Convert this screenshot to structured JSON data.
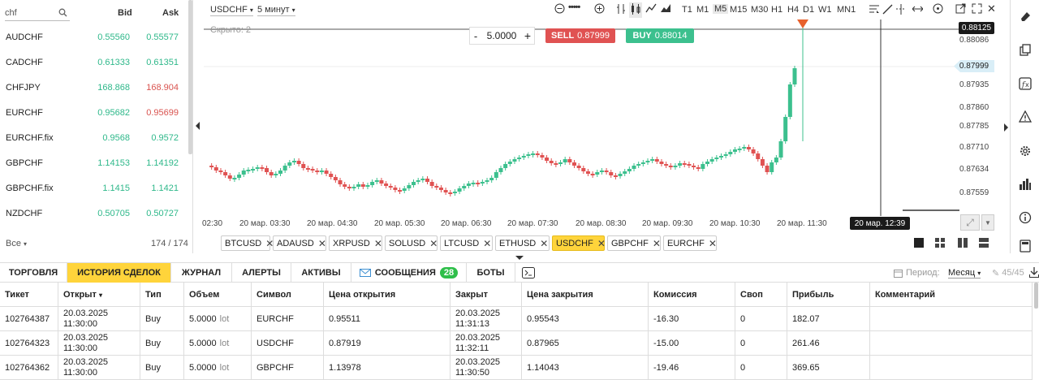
{
  "watchlist": {
    "search_value": "chf",
    "bid_header": "Bid",
    "ask_header": "Ask",
    "rows": [
      {
        "symbol": "AUDCHF",
        "bid": "0.55560",
        "ask": "0.55577",
        "bid_color": "g",
        "ask_color": "g"
      },
      {
        "symbol": "CADCHF",
        "bid": "0.61333",
        "ask": "0.61351",
        "bid_color": "g",
        "ask_color": "g"
      },
      {
        "symbol": "CHFJPY",
        "bid": "168.868",
        "ask": "168.904",
        "bid_color": "g",
        "ask_color": "r"
      },
      {
        "symbol": "EURCHF",
        "bid": "0.95682",
        "ask": "0.95699",
        "bid_color": "g",
        "ask_color": "r"
      },
      {
        "symbol": "EURCHF.fix",
        "bid": "0.9568",
        "ask": "0.9572",
        "bid_color": "g",
        "ask_color": "g"
      },
      {
        "symbol": "GBPCHF",
        "bid": "1.14153",
        "ask": "1.14192",
        "bid_color": "g",
        "ask_color": "g"
      },
      {
        "symbol": "GBPCHF.fix",
        "bid": "1.1415",
        "ask": "1.1421",
        "bid_color": "g",
        "ask_color": "g"
      },
      {
        "symbol": "NZDCHF",
        "bid": "0.50705",
        "ask": "0.50727",
        "bid_color": "g",
        "ask_color": "g"
      }
    ],
    "filter_label": "Все",
    "count": "174 / 174"
  },
  "toolbar": {
    "symbol": "USDCHF",
    "period": "5 минут",
    "timeframes": [
      "T1",
      "M1",
      "M5",
      "M15",
      "M30",
      "H1",
      "H4",
      "D1",
      "W1",
      "MN1"
    ],
    "active_timeframe": "M5"
  },
  "trade": {
    "hidden_label": "Скрыто: 2",
    "minus": "-",
    "plus": "+",
    "volume": "5.0000",
    "sell_label": "SELL",
    "sell_price": "0.87999",
    "buy_label": "BUY",
    "buy_price": "0.88014"
  },
  "chart": {
    "price_labels": [
      "0.88086",
      "0.87935",
      "0.87860",
      "0.87785",
      "0.87710",
      "0.87634",
      "0.87559"
    ],
    "current_price": "0.87999",
    "cursor_price": "0.88125",
    "time_labels": [
      "02:30",
      "20 мар. 03:30",
      "20 мар. 04:30",
      "20 мар. 05:30",
      "20 мар. 06:30",
      "20 мар. 07:30",
      "20 мар. 08:30",
      "20 мар. 09:30",
      "20 мар. 10:30",
      "20 мар. 11:30"
    ],
    "cursor_time": "20 мар. 12:39",
    "up_color": "#3cc08e",
    "down_color": "#e05252"
  },
  "symbol_tabs": [
    "BTCUSD",
    "ADAUSD",
    "XRPUSD",
    "SOLUSD",
    "LTCUSD",
    "ETHUSD",
    "USDCHF",
    "GBPCHF",
    "EURCHF"
  ],
  "active_symbol_tab": "USDCHF",
  "bottom_tabs": {
    "trading": "ТОРГОВЛЯ",
    "history": "ИСТОРИЯ СДЕЛОК",
    "journal": "ЖУРНАЛ",
    "alerts": "АЛЕРТЫ",
    "assets": "АКТИВЫ",
    "messages": "СООБЩЕНИЯ",
    "messages_count": "28",
    "bots": "БОТЫ"
  },
  "period_filter": {
    "label": "Период:",
    "value": "Месяц",
    "count": "45/45"
  },
  "table": {
    "headers": [
      "Тикет",
      "Открыт",
      "Тип",
      "Объем",
      "Символ",
      "Цена открытия",
      "Закрыт",
      "Цена закрытия",
      "Комиссия",
      "Своп",
      "Прибыль",
      "Комментарий"
    ],
    "lot_unit": "lot",
    "rows": [
      {
        "ticket": "102764387",
        "open_date": "20.03.2025",
        "open_time": "11:30:00",
        "type": "Buy",
        "volume": "5.0000",
        "symbol": "EURCHF",
        "open_price": "0.95511",
        "close_date": "20.03.2025",
        "close_time": "11:31:13",
        "close_price": "0.95543",
        "commission": "-16.30",
        "swap": "0",
        "profit": "182.07"
      },
      {
        "ticket": "102764323",
        "open_date": "20.03.2025",
        "open_time": "11:30:00",
        "type": "Buy",
        "volume": "5.0000",
        "symbol": "USDCHF",
        "open_price": "0.87919",
        "close_date": "20.03.2025",
        "close_time": "11:32:11",
        "close_price": "0.87965",
        "commission": "-15.00",
        "swap": "0",
        "profit": "261.46"
      },
      {
        "ticket": "102764362",
        "open_date": "20.03.2025",
        "open_time": "11:30:00",
        "type": "Buy",
        "volume": "5.0000",
        "symbol": "GBPCHF",
        "open_price": "1.13978",
        "close_date": "20.03.2025",
        "close_time": "11:30:50",
        "close_price": "1.14043",
        "commission": "-19.46",
        "swap": "0",
        "profit": "369.65"
      }
    ]
  }
}
